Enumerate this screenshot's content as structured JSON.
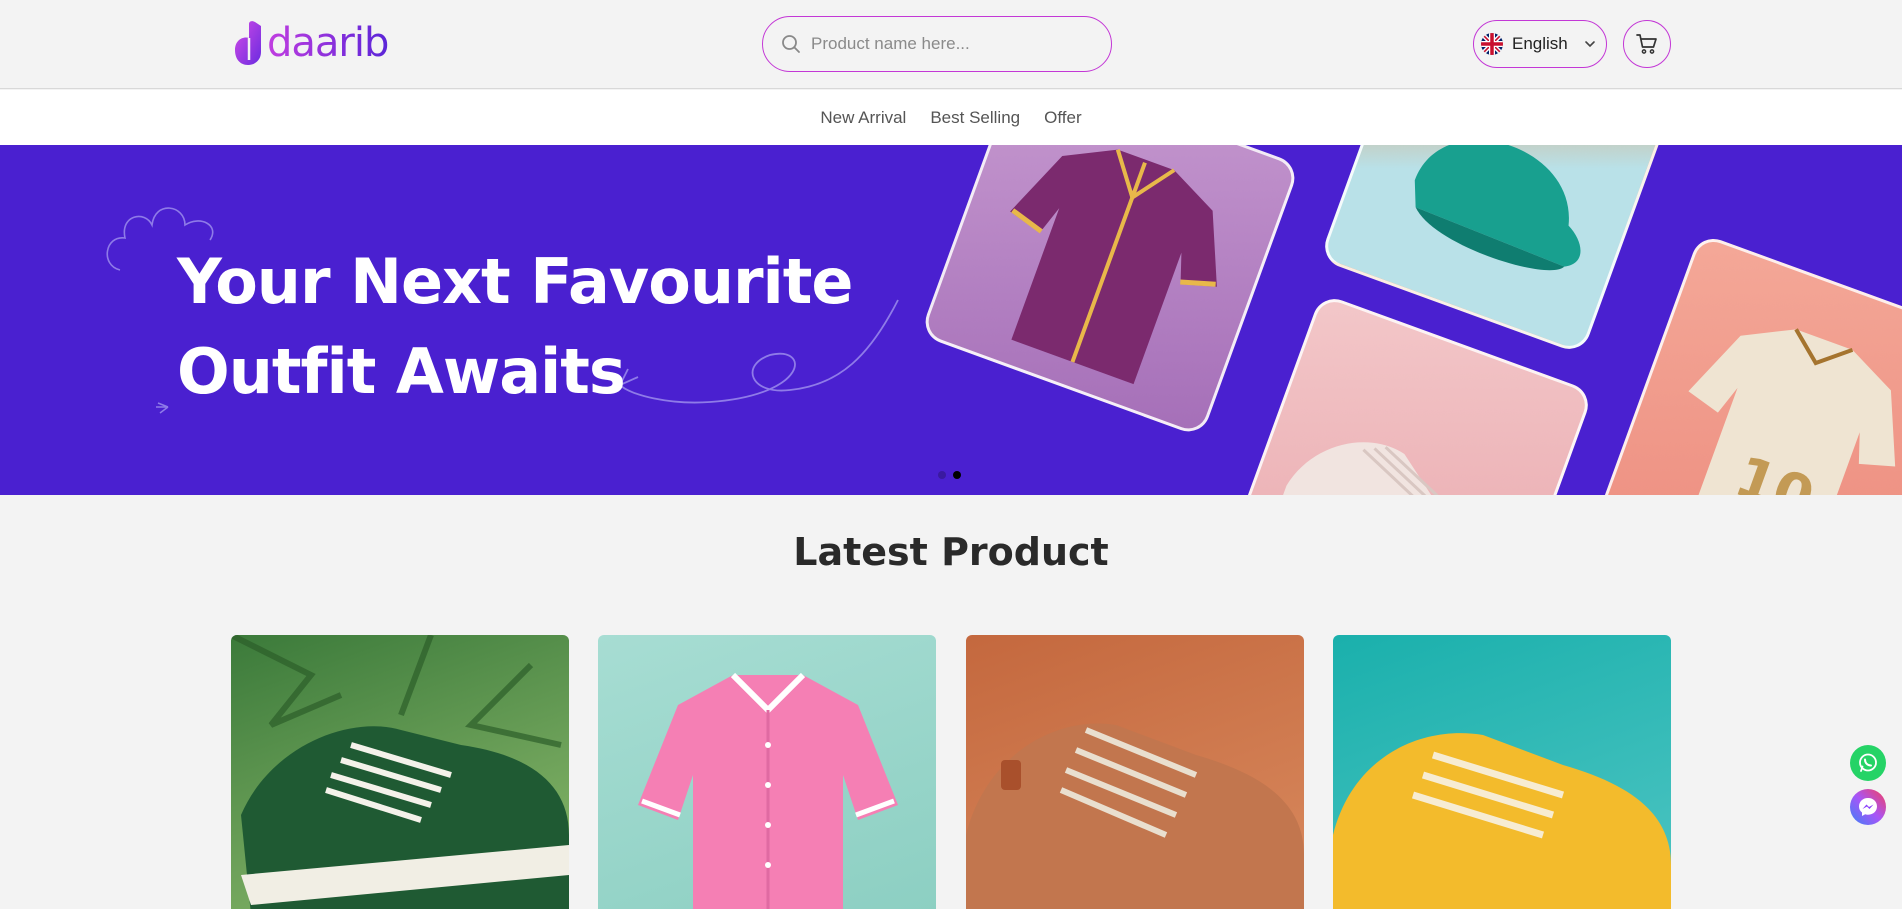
{
  "brand": {
    "name": "daarib"
  },
  "search": {
    "placeholder": "Product name here..."
  },
  "language": {
    "selected": "English"
  },
  "nav": {
    "items": [
      "New Arrival",
      "Best Selling",
      "Offer"
    ]
  },
  "banner": {
    "headline_line1": "Your Next Favourite",
    "headline_line2": "Outfit Awaits",
    "slides": 2,
    "active_slide": 2
  },
  "latest": {
    "title": "Latest Product",
    "products": [
      {
        "image": "green-canvas-sneakers"
      },
      {
        "image": "pink-baseball-shirt"
      },
      {
        "image": "orange-leather-sneakers"
      },
      {
        "image": "yellow-sneakers"
      }
    ]
  },
  "colors": {
    "accent": "#c337d6",
    "banner": "#4a20d0",
    "whatsapp": "#25d366",
    "messenger": "#8a3ffc"
  },
  "floating": {
    "icons": [
      "whatsapp-icon",
      "messenger-icon"
    ]
  }
}
